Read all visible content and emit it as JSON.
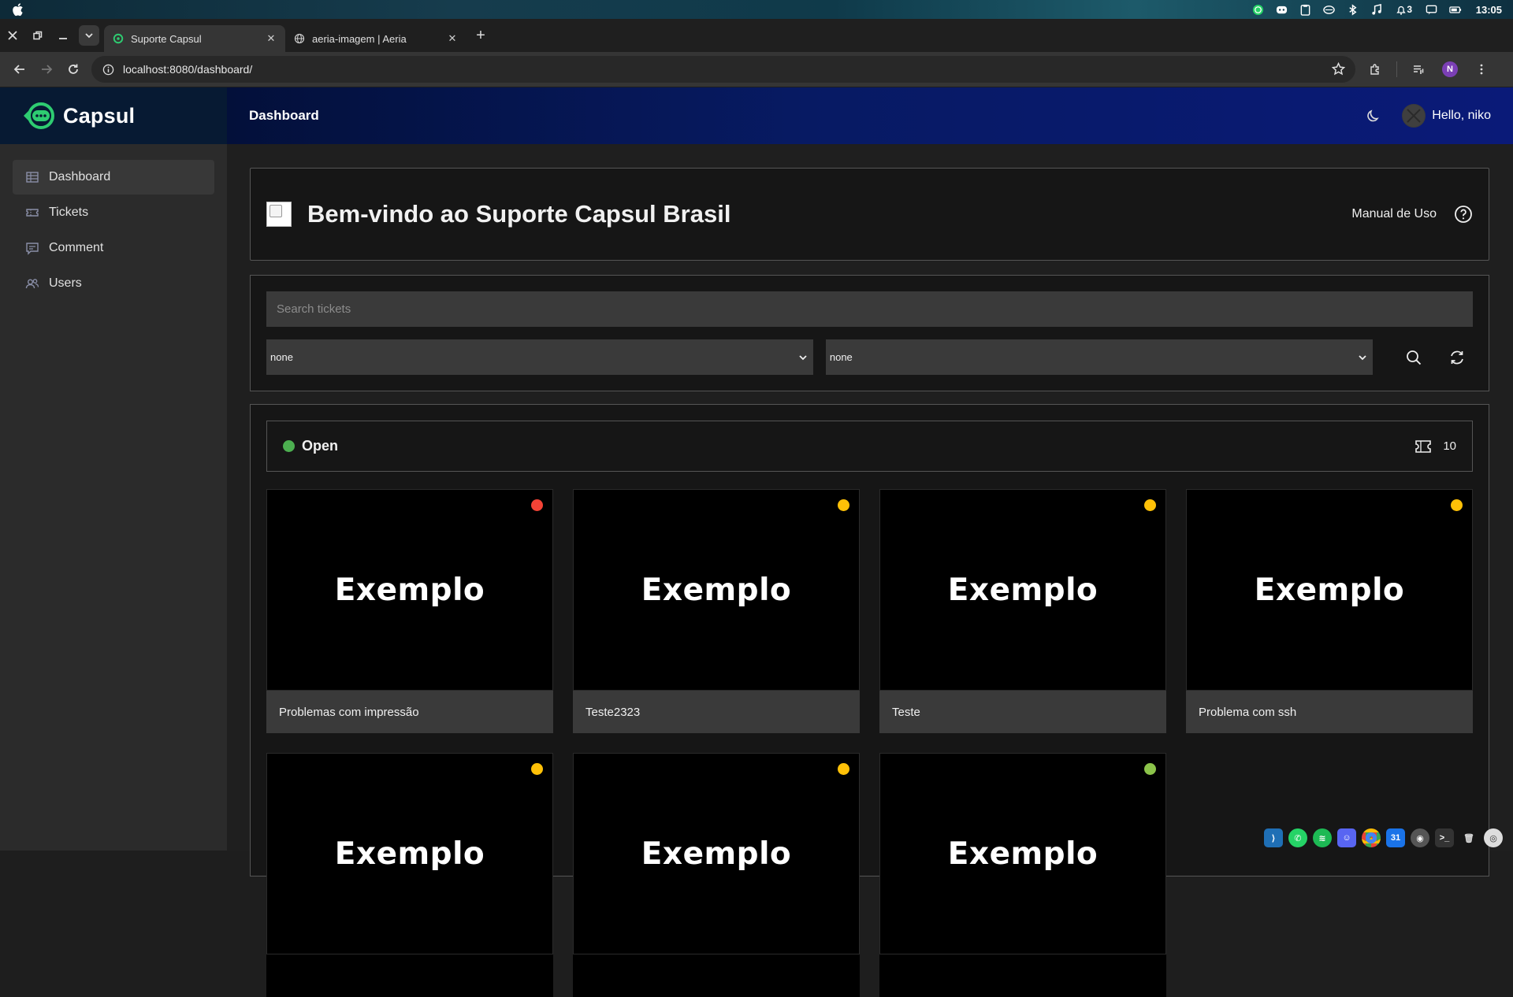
{
  "os": {
    "clock": "13:05",
    "notifications": "3",
    "tray_icons": [
      "whatsapp-icon",
      "discord-icon",
      "clipboard-icon",
      "drive-icon",
      "bluetooth-icon",
      "music-icon",
      "bell-icon",
      "chat-icon",
      "battery-icon"
    ]
  },
  "browser": {
    "tabs": [
      {
        "title": "Suporte Capsul",
        "active": true
      },
      {
        "title": "aeria-imagem | Aeria",
        "active": false
      }
    ],
    "url": "localhost:8080/dashboard/",
    "profile_initial": "N"
  },
  "app": {
    "brand": "Capsul",
    "sidebar": {
      "items": [
        {
          "label": "Dashboard",
          "icon": "table-icon",
          "active": true
        },
        {
          "label": "Tickets",
          "icon": "ticket-icon",
          "active": false
        },
        {
          "label": "Comment",
          "icon": "comment-icon",
          "active": false
        },
        {
          "label": "Users",
          "icon": "users-icon",
          "active": false
        }
      ]
    },
    "header": {
      "title": "Dashboard",
      "greeting": "Hello, niko"
    },
    "welcome": {
      "title": "Bem-vindo ao Suporte Capsul Brasil",
      "manual_label": "Manual de Uso"
    },
    "filters": {
      "search_placeholder": "Search tickets",
      "select_1": "none",
      "select_2": "none"
    },
    "board": {
      "column_title": "Open",
      "column_color": "#4caf50",
      "count": "10",
      "cards": [
        {
          "image_text": "Exemplo",
          "title": "Problemas com impressão",
          "priority_color": "#f44336"
        },
        {
          "image_text": "Exemplo",
          "title": "Teste2323",
          "priority_color": "#ffc107"
        },
        {
          "image_text": "Exemplo",
          "title": "Teste",
          "priority_color": "#ffc107"
        },
        {
          "image_text": "Exemplo",
          "title": "Problema com ssh",
          "priority_color": "#ffc107"
        },
        {
          "image_text": "Exemplo",
          "title": "",
          "priority_color": "#ffc107"
        },
        {
          "image_text": "Exemplo",
          "title": "",
          "priority_color": "#ffc107"
        },
        {
          "image_text": "Exemplo",
          "title": "",
          "priority_color": "#8bc34a"
        }
      ]
    }
  },
  "dock": {
    "items": [
      "vscode-icon",
      "whatsapp-icon",
      "spotify-icon",
      "discord-icon",
      "chrome-icon",
      "calendar-icon",
      "github-icon",
      "terminal-icon",
      "trash-icon",
      "screenshot-icon"
    ],
    "calendar_day": "31"
  }
}
